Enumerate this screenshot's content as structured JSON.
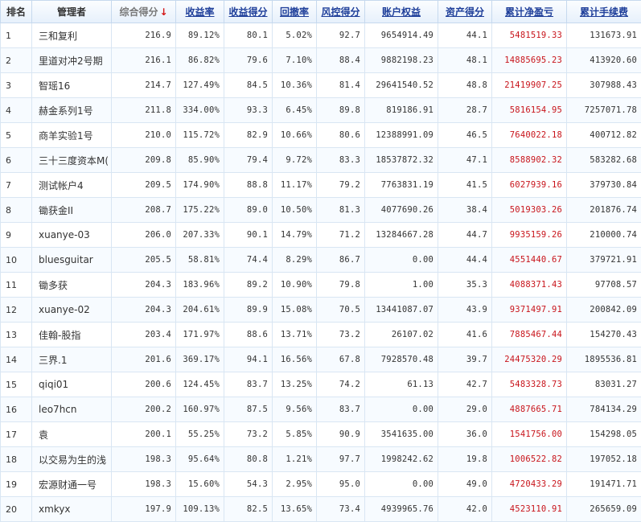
{
  "columns": {
    "rank": "排名",
    "manager": "管理者",
    "score": "综合得分",
    "return_rate": "收益率",
    "return_score": "收益得分",
    "drawdown": "回撤率",
    "risk_score": "风控得分",
    "equity": "账户权益",
    "asset_score": "资产得分",
    "net_profit": "累计净盈亏",
    "fees": "累计手续费"
  },
  "sort_icon": "arrow-down-icon",
  "colors": {
    "profit": "#c8141b",
    "header_link": "#1f3f9a"
  },
  "rows": [
    {
      "rank": "1",
      "manager": "三和复利",
      "score": "216.9",
      "return_rate": "89.12%",
      "return_score": "80.1",
      "drawdown": "5.02%",
      "risk_score": "92.7",
      "equity": "9654914.49",
      "asset_score": "44.1",
      "net_profit": "5481519.33",
      "fees": "131673.91"
    },
    {
      "rank": "2",
      "manager": "里道对冲2号期",
      "score": "216.1",
      "return_rate": "86.82%",
      "return_score": "79.6",
      "drawdown": "7.10%",
      "risk_score": "88.4",
      "equity": "9882198.23",
      "asset_score": "48.1",
      "net_profit": "14885695.23",
      "fees": "413920.60"
    },
    {
      "rank": "3",
      "manager": "智瑶16",
      "score": "214.7",
      "return_rate": "127.49%",
      "return_score": "84.5",
      "drawdown": "10.36%",
      "risk_score": "81.4",
      "equity": "29641540.52",
      "asset_score": "48.8",
      "net_profit": "21419907.25",
      "fees": "307988.43"
    },
    {
      "rank": "4",
      "manager": "赫金系列1号",
      "score": "211.8",
      "return_rate": "334.00%",
      "return_score": "93.3",
      "drawdown": "6.45%",
      "risk_score": "89.8",
      "equity": "819186.91",
      "asset_score": "28.7",
      "net_profit": "5816154.95",
      "fees": "7257071.78"
    },
    {
      "rank": "5",
      "manager": "商羊实验1号",
      "score": "210.0",
      "return_rate": "115.72%",
      "return_score": "82.9",
      "drawdown": "10.66%",
      "risk_score": "80.6",
      "equity": "12388991.09",
      "asset_score": "46.5",
      "net_profit": "7640022.18",
      "fees": "400712.82"
    },
    {
      "rank": "6",
      "manager": "三十三度资本M(",
      "score": "209.8",
      "return_rate": "85.90%",
      "return_score": "79.4",
      "drawdown": "9.72%",
      "risk_score": "83.3",
      "equity": "18537872.32",
      "asset_score": "47.1",
      "net_profit": "8588902.32",
      "fees": "583282.68"
    },
    {
      "rank": "7",
      "manager": "测试帐户4",
      "score": "209.5",
      "return_rate": "174.90%",
      "return_score": "88.8",
      "drawdown": "11.17%",
      "risk_score": "79.2",
      "equity": "7763831.19",
      "asset_score": "41.5",
      "net_profit": "6027939.16",
      "fees": "379730.84"
    },
    {
      "rank": "8",
      "manager": "锄获金II",
      "score": "208.7",
      "return_rate": "175.22%",
      "return_score": "89.0",
      "drawdown": "10.50%",
      "risk_score": "81.3",
      "equity": "4077690.26",
      "asset_score": "38.4",
      "net_profit": "5019303.26",
      "fees": "201876.74"
    },
    {
      "rank": "9",
      "manager": "xuanye-03",
      "score": "206.0",
      "return_rate": "207.33%",
      "return_score": "90.1",
      "drawdown": "14.79%",
      "risk_score": "71.2",
      "equity": "13284667.28",
      "asset_score": "44.7",
      "net_profit": "9935159.26",
      "fees": "210000.74"
    },
    {
      "rank": "10",
      "manager": "bluesguitar",
      "score": "205.5",
      "return_rate": "58.81%",
      "return_score": "74.4",
      "drawdown": "8.29%",
      "risk_score": "86.7",
      "equity": "0.00",
      "asset_score": "44.4",
      "net_profit": "4551440.67",
      "fees": "379721.91"
    },
    {
      "rank": "11",
      "manager": "锄多获",
      "score": "204.3",
      "return_rate": "183.96%",
      "return_score": "89.2",
      "drawdown": "10.90%",
      "risk_score": "79.8",
      "equity": "1.00",
      "asset_score": "35.3",
      "net_profit": "4088371.43",
      "fees": "97708.57"
    },
    {
      "rank": "12",
      "manager": "xuanye-02",
      "score": "204.3",
      "return_rate": "204.61%",
      "return_score": "89.9",
      "drawdown": "15.08%",
      "risk_score": "70.5",
      "equity": "13441087.07",
      "asset_score": "43.9",
      "net_profit": "9371497.91",
      "fees": "200842.09"
    },
    {
      "rank": "13",
      "manager": "佳翰-股指",
      "score": "203.4",
      "return_rate": "171.97%",
      "return_score": "88.6",
      "drawdown": "13.71%",
      "risk_score": "73.2",
      "equity": "26107.02",
      "asset_score": "41.6",
      "net_profit": "7885467.44",
      "fees": "154270.43"
    },
    {
      "rank": "14",
      "manager": "三界.1",
      "score": "201.6",
      "return_rate": "369.17%",
      "return_score": "94.1",
      "drawdown": "16.56%",
      "risk_score": "67.8",
      "equity": "7928570.48",
      "asset_score": "39.7",
      "net_profit": "24475320.29",
      "fees": "1895536.81"
    },
    {
      "rank": "15",
      "manager": "qiqi01",
      "score": "200.6",
      "return_rate": "124.45%",
      "return_score": "83.7",
      "drawdown": "13.25%",
      "risk_score": "74.2",
      "equity": "61.13",
      "asset_score": "42.7",
      "net_profit": "5483328.73",
      "fees": "83031.27"
    },
    {
      "rank": "16",
      "manager": "leo7hcn",
      "score": "200.2",
      "return_rate": "160.97%",
      "return_score": "87.5",
      "drawdown": "9.56%",
      "risk_score": "83.7",
      "equity": "0.00",
      "asset_score": "29.0",
      "net_profit": "4887665.71",
      "fees": "784134.29"
    },
    {
      "rank": "17",
      "manager": "袁",
      "score": "200.1",
      "return_rate": "55.25%",
      "return_score": "73.2",
      "drawdown": "5.85%",
      "risk_score": "90.9",
      "equity": "3541635.00",
      "asset_score": "36.0",
      "net_profit": "1541756.00",
      "fees": "154298.05"
    },
    {
      "rank": "18",
      "manager": "以交易为生的浅",
      "score": "198.3",
      "return_rate": "95.64%",
      "return_score": "80.8",
      "drawdown": "1.21%",
      "risk_score": "97.7",
      "equity": "1998242.62",
      "asset_score": "19.8",
      "net_profit": "1006522.82",
      "fees": "197052.18"
    },
    {
      "rank": "19",
      "manager": "宏源财通一号",
      "score": "198.3",
      "return_rate": "15.60%",
      "return_score": "54.3",
      "drawdown": "2.95%",
      "risk_score": "95.0",
      "equity": "0.00",
      "asset_score": "49.0",
      "net_profit": "4720433.29",
      "fees": "191471.71"
    },
    {
      "rank": "20",
      "manager": "xmkyx",
      "score": "197.9",
      "return_rate": "109.13%",
      "return_score": "82.5",
      "drawdown": "13.65%",
      "risk_score": "73.4",
      "equity": "4939965.76",
      "asset_score": "42.0",
      "net_profit": "4523110.91",
      "fees": "265659.09"
    }
  ]
}
